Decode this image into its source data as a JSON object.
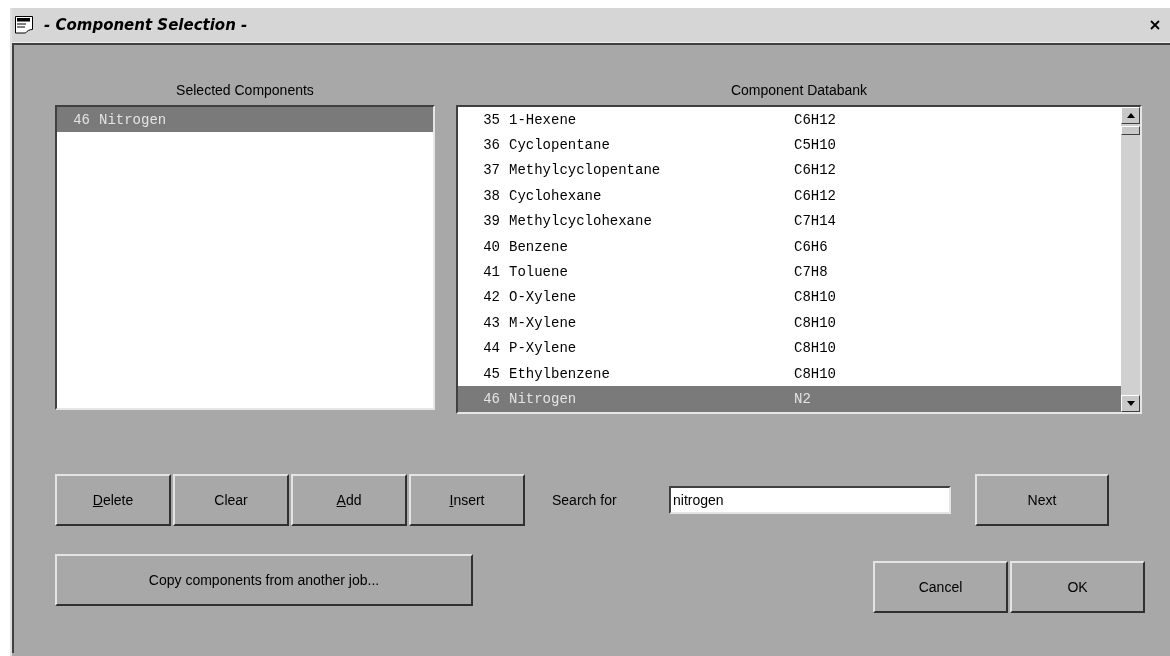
{
  "window": {
    "title": "- Component Selection -"
  },
  "selected_components": {
    "heading": "Selected Components",
    "rows": [
      {
        "number": "46",
        "name": "Nitrogen",
        "selected": true
      }
    ]
  },
  "component_databank": {
    "heading": "Component Databank",
    "rows": [
      {
        "number": "35",
        "name": "1-Hexene",
        "formula": "C6H12",
        "selected": false
      },
      {
        "number": "36",
        "name": "Cyclopentane",
        "formula": "C5H10",
        "selected": false
      },
      {
        "number": "37",
        "name": "Methylcyclopentane",
        "formula": "C6H12",
        "selected": false
      },
      {
        "number": "38",
        "name": "Cyclohexane",
        "formula": "C6H12",
        "selected": false
      },
      {
        "number": "39",
        "name": "Methylcyclohexane",
        "formula": "C7H14",
        "selected": false
      },
      {
        "number": "40",
        "name": "Benzene",
        "formula": "C6H6",
        "selected": false
      },
      {
        "number": "41",
        "name": "Toluene",
        "formula": "C7H8",
        "selected": false
      },
      {
        "number": "42",
        "name": "O-Xylene",
        "formula": "C8H10",
        "selected": false
      },
      {
        "number": "43",
        "name": "M-Xylene",
        "formula": "C8H10",
        "selected": false
      },
      {
        "number": "44",
        "name": "P-Xylene",
        "formula": "C8H10",
        "selected": false
      },
      {
        "number": "45",
        "name": "Ethylbenzene",
        "formula": "C8H10",
        "selected": false
      },
      {
        "number": "46",
        "name": "Nitrogen",
        "formula": "N2",
        "selected": true
      }
    ]
  },
  "edit_buttons": [
    {
      "label": "Delete",
      "mnemonic": true
    },
    {
      "label": "Clear",
      "mnemonic": false
    },
    {
      "label": "Add",
      "mnemonic": true
    },
    {
      "label": "Insert",
      "mnemonic": true
    }
  ],
  "search": {
    "label": "Search for",
    "value": "nitrogen"
  },
  "next_button": "Next",
  "copy_button": "Copy components from another job...",
  "dialog_buttons": [
    "Cancel",
    "OK"
  ]
}
